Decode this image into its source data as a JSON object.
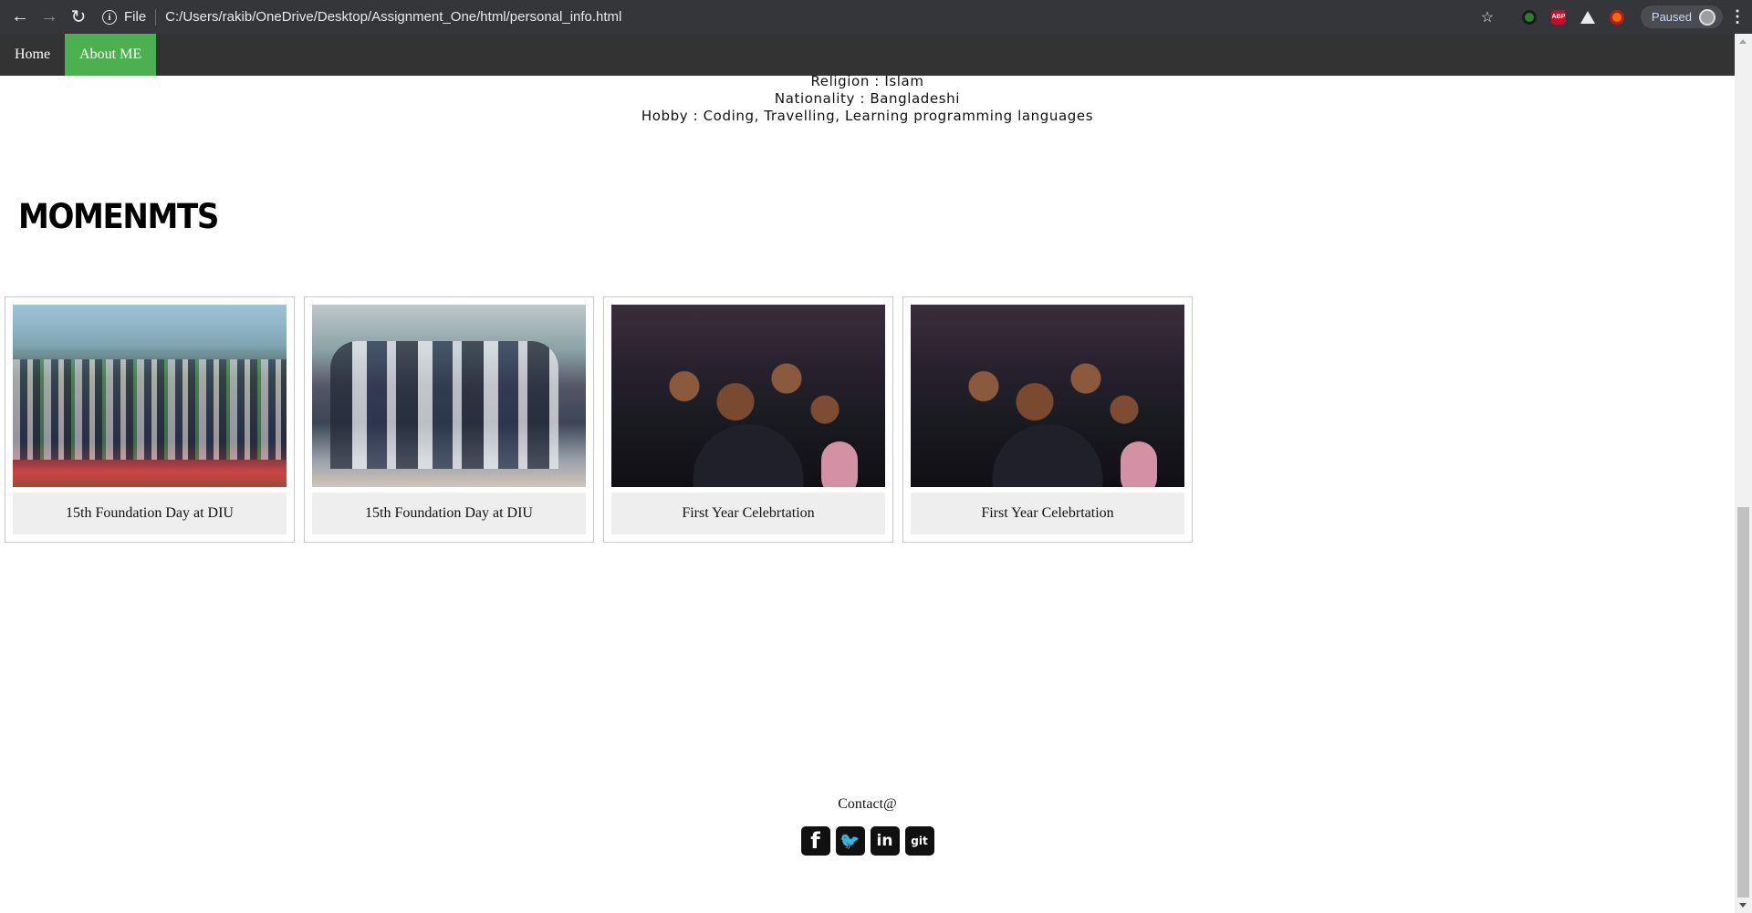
{
  "browser": {
    "url_scheme": "File",
    "url": "C:/Users/rakib/OneDrive/Desktop/Assignment_One/html/personal_info.html",
    "profile_status": "Paused"
  },
  "nav": {
    "items": [
      {
        "label": "Home"
      },
      {
        "label": "About ME"
      }
    ]
  },
  "info": {
    "religion": "Religion : Islam",
    "nationality": "Nationality : Bangladeshi",
    "hobby": "Hobby : Coding, Travelling, Learning programming languages"
  },
  "moments": {
    "title": "MOMENMTS",
    "cards": [
      {
        "caption": "15th Foundation Day at DIU"
      },
      {
        "caption": "15th Foundation Day at DIU"
      },
      {
        "caption": "First Year Celebrtation"
      },
      {
        "caption": "First Year Celebrtation"
      }
    ]
  },
  "footer": {
    "contact": "Contact@",
    "socials": [
      {
        "icon": "facebook-icon",
        "glyph": "f"
      },
      {
        "icon": "twitter-icon",
        "glyph": "🐦"
      },
      {
        "icon": "linkedin-icon",
        "glyph": "in"
      },
      {
        "icon": "github-icon",
        "glyph": "git"
      }
    ]
  },
  "colors": {
    "nav_bg": "#333333",
    "nav_active": "#4caf50",
    "chrome_bg": "#35363a"
  }
}
